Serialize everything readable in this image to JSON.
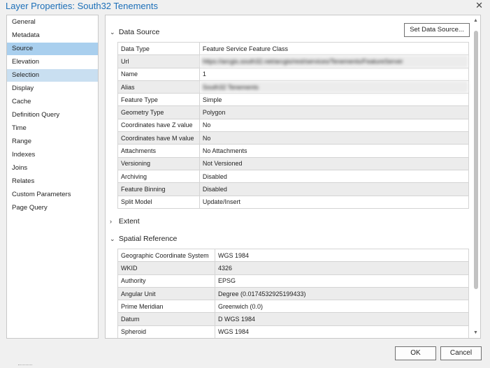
{
  "window": {
    "title": "Layer Properties: South32 Tenements",
    "close_glyph": "✕"
  },
  "sidebar": {
    "items": [
      {
        "label": "General"
      },
      {
        "label": "Metadata"
      },
      {
        "label": "Source",
        "state": "selected"
      },
      {
        "label": "Elevation"
      },
      {
        "label": "Selection",
        "state": "hovered"
      },
      {
        "label": "Display"
      },
      {
        "label": "Cache"
      },
      {
        "label": "Definition Query"
      },
      {
        "label": "Time"
      },
      {
        "label": "Range"
      },
      {
        "label": "Indexes"
      },
      {
        "label": "Joins"
      },
      {
        "label": "Relates"
      },
      {
        "label": "Custom Parameters"
      },
      {
        "label": "Page Query"
      }
    ]
  },
  "data_source": {
    "header": "Data Source",
    "set_button": "Set Data Source...",
    "rows": [
      {
        "key": "Data Type",
        "value": "Feature Service Feature Class"
      },
      {
        "key": "Url",
        "value": "https://arcgis.south32.net/arcgis/rest/services/Tenements/FeatureServer",
        "redacted": true
      },
      {
        "key": "Name",
        "value": "1"
      },
      {
        "key": "Alias",
        "value": "South32 Tenements",
        "redacted": true
      },
      {
        "key": "Feature Type",
        "value": "Simple"
      },
      {
        "key": "Geometry Type",
        "value": "Polygon"
      },
      {
        "key": "Coordinates have Z value",
        "value": "No"
      },
      {
        "key": "Coordinates have M value",
        "value": "No"
      },
      {
        "key": "Attachments",
        "value": "No Attachments"
      },
      {
        "key": "Versioning",
        "value": "Not Versioned"
      },
      {
        "key": "Archiving",
        "value": "Disabled"
      },
      {
        "key": "Feature Binning",
        "value": "Disabled"
      },
      {
        "key": "Split Model",
        "value": "Update/Insert"
      }
    ]
  },
  "extent": {
    "header": "Extent"
  },
  "spatial_reference": {
    "header": "Spatial Reference",
    "rows": [
      {
        "key": "Geographic Coordinate System",
        "value": "WGS 1984"
      },
      {
        "key": "WKID",
        "value": "4326"
      },
      {
        "key": "Authority",
        "value": "EPSG"
      },
      {
        "key": "Angular Unit",
        "value": "Degree (0.0174532925199433)"
      },
      {
        "key": "Prime Meridian",
        "value": "Greenwich (0.0)"
      },
      {
        "key": "Datum",
        "value": "D WGS 1984"
      },
      {
        "key": "Spheroid",
        "value": "WGS 1984"
      }
    ]
  },
  "footer": {
    "ok_label": "OK",
    "cancel_label": "Cancel"
  },
  "icons": {
    "expanded": "chevron-down-icon",
    "collapsed": "chevron-right-icon"
  }
}
